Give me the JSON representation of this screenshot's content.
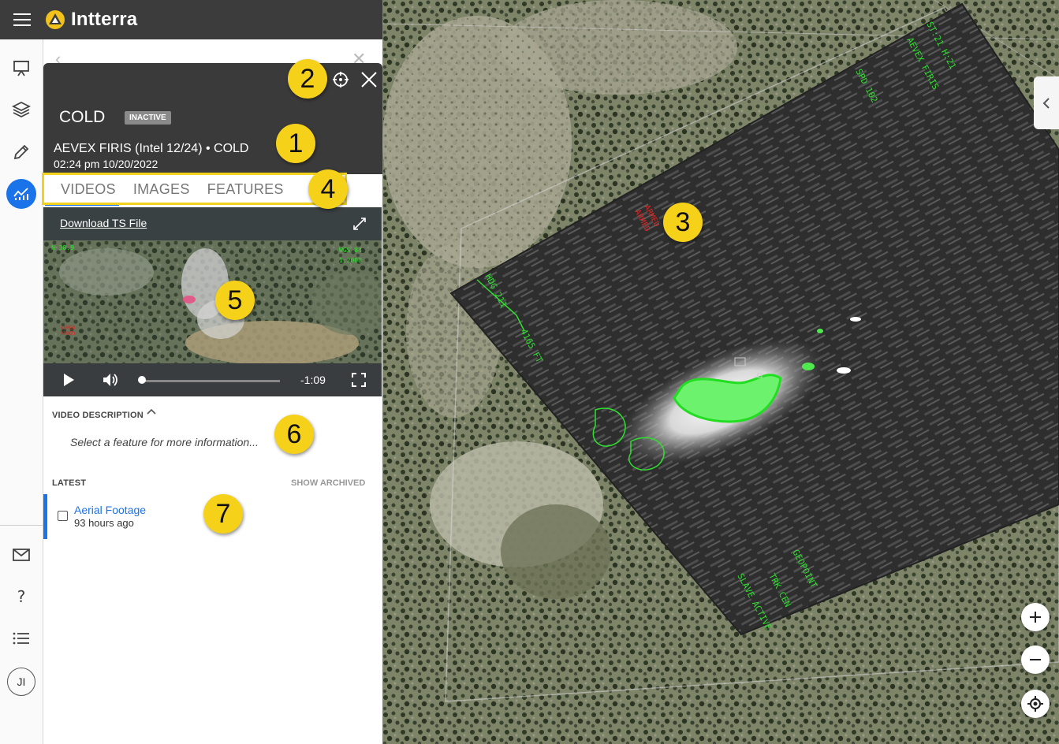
{
  "app": {
    "brand": "Intterra"
  },
  "rail": {
    "avatar_initials": "JI"
  },
  "feature": {
    "title": "COLD",
    "status_badge": "INACTIVE",
    "source": "AEVEX FIRIS (Intel 12/24) • COLD",
    "timestamp": "02:24 pm 10/20/2022"
  },
  "tabs": [
    "VIDEOS",
    "IMAGES",
    "FEATURES"
  ],
  "video": {
    "download_label": "Download TS File",
    "time_remaining": "-1:09",
    "progress": 0
  },
  "description": {
    "label": "VIDEO DESCRIPTION",
    "empty_text": "Select a feature for more information..."
  },
  "latest": {
    "label": "LATEST",
    "show_archived": "SHOW ARCHIVED",
    "items": [
      {
        "title": "Aerial Footage",
        "age": "93 hours ago"
      }
    ]
  },
  "callouts": [
    "1",
    "2",
    "3",
    "4",
    "5",
    "6",
    "7"
  ],
  "colors": {
    "accent": "#1a73e8",
    "callout": "#f6d11a",
    "header": "#3a3a3a",
    "ir_hotspot": "#3cff3c"
  },
  "icons": [
    "menu-icon",
    "intterra-logo-icon",
    "presentation-icon",
    "layers-icon",
    "pencil-icon",
    "analytics-icon",
    "mail-icon",
    "help-icon",
    "list-icon",
    "locate-icon",
    "close-icon",
    "expand-icon",
    "play-icon",
    "volume-icon",
    "fullscreen-icon",
    "chevron-up-icon",
    "chevron-left-icon",
    "zoom-in-icon",
    "zoom-out-icon",
    "my-location-icon"
  ]
}
